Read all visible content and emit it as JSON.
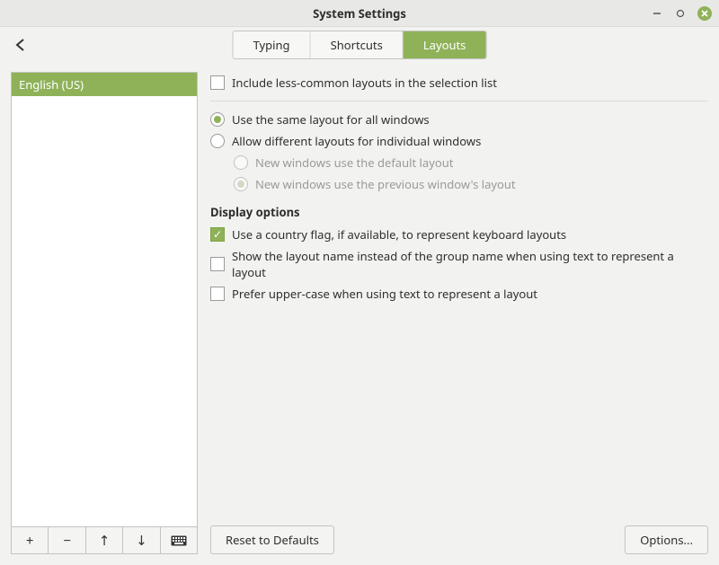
{
  "window": {
    "title": "System Settings"
  },
  "tabs": {
    "typing": "Typing",
    "shortcuts": "Shortcuts",
    "layouts": "Layouts",
    "active": "layouts"
  },
  "layout_list": {
    "items": [
      "English (US)"
    ]
  },
  "options": {
    "include_less_common": "Include less-common layouts in the selection list",
    "same_layout_all": "Use the same layout for all windows",
    "allow_different": "Allow different layouts for individual windows",
    "new_default": "New windows use the default layout",
    "new_previous": "New windows use the previous window's layout"
  },
  "display": {
    "heading": "Display options",
    "country_flag": "Use a country flag, if available,  to represent keyboard layouts",
    "layout_name": "Show the layout name instead of the group name when using text to represent a layout",
    "upper_case": "Prefer upper-case when using text to represent a layout"
  },
  "buttons": {
    "reset": "Reset to Defaults",
    "options": "Options..."
  }
}
